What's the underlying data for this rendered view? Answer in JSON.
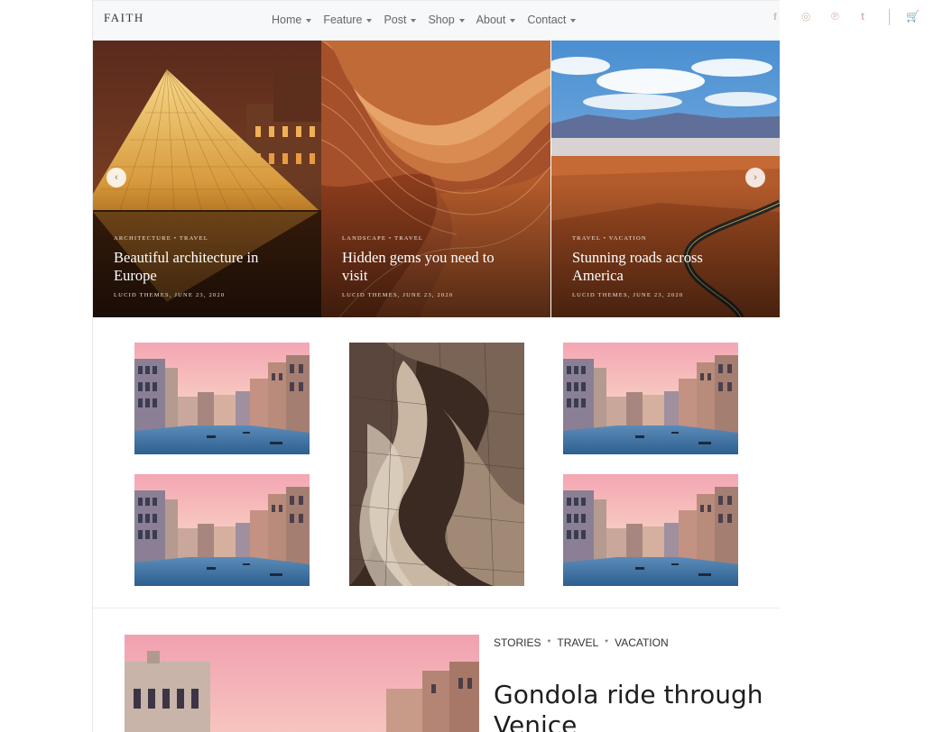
{
  "brand": {
    "logo": "FAITH"
  },
  "nav": {
    "items": [
      {
        "label": "Home"
      },
      {
        "label": "Feature"
      },
      {
        "label": "Post"
      },
      {
        "label": "Shop"
      },
      {
        "label": "About"
      },
      {
        "label": "Contact"
      }
    ]
  },
  "social": {
    "facebook": "f",
    "instagram": "◎",
    "pinterest": "℗",
    "twitter": "t",
    "cart": "🛒"
  },
  "slider": {
    "prev": "‹",
    "next": "›",
    "slides": [
      {
        "category": "Architecture • Travel",
        "title": "Beautiful architecture in Europe",
        "meta": "Lucid Themes, June 23, 2020"
      },
      {
        "category": "Landscape • Travel",
        "title": "Hidden gems you need to visit",
        "meta": "Lucid Themes, June 23, 2020"
      },
      {
        "category": "Travel • Vacation",
        "title": "Stunning roads across America",
        "meta": "Lucid Themes, June 23, 2020"
      }
    ]
  },
  "post": {
    "categories": [
      "STORIES",
      "TRAVEL",
      "VACATION"
    ],
    "separator": "*",
    "title": "Gondola ride through Venice"
  },
  "colors": {
    "accent": "#d6b8b0",
    "text": "#1e1e1e"
  }
}
